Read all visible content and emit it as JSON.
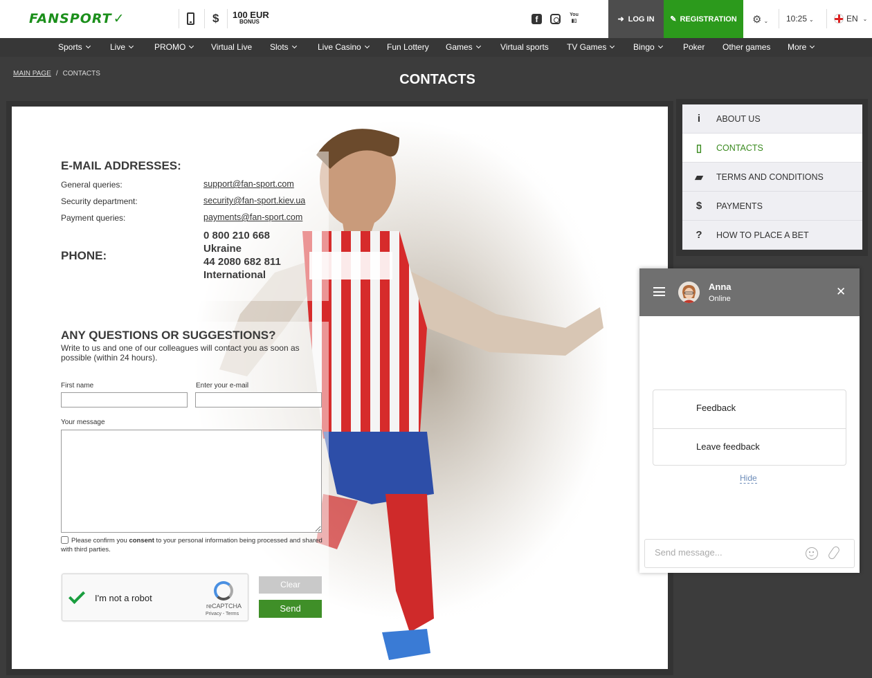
{
  "header": {
    "logo": "FANSPORT",
    "bonus_amount": "100 EUR",
    "bonus_label": "BONUS",
    "login": "LOG IN",
    "registration": "REGISTRATION",
    "time": "10:25",
    "language": "EN",
    "icons": [
      "mobile-phone-icon",
      "dollar-icon",
      "facebook-icon",
      "instagram-icon",
      "youtube-icon",
      "settings-icon",
      "uk-flag-icon"
    ]
  },
  "nav": [
    {
      "label": "Sports",
      "dropdown": true
    },
    {
      "label": "Live",
      "dropdown": true
    },
    {
      "label": "PROMO",
      "dropdown": true
    },
    {
      "label": "Virtual Live",
      "dropdown": false
    },
    {
      "label": "Slots",
      "dropdown": true
    },
    {
      "label": "Live Casino",
      "dropdown": true
    },
    {
      "label": "Fun Lottery",
      "dropdown": false
    },
    {
      "label": "Games",
      "dropdown": true
    },
    {
      "label": "Virtual sports",
      "dropdown": false
    },
    {
      "label": "TV Games",
      "dropdown": true
    },
    {
      "label": "Bingo",
      "dropdown": true
    },
    {
      "label": "Poker",
      "dropdown": false
    },
    {
      "label": "Other games",
      "dropdown": false
    },
    {
      "label": "More",
      "dropdown": true
    }
  ],
  "breadcrumb": {
    "home": "MAIN PAGE",
    "separator": "/",
    "current": "CONTACTS"
  },
  "page_title": "CONTACTS",
  "contacts": {
    "email_heading": "E-MAIL ADDRESSES:",
    "emails": [
      {
        "label": "General queries:",
        "address": "support@fan-sport.com"
      },
      {
        "label": "Security department:",
        "address": "security@fan-sport.kiev.ua"
      },
      {
        "label": "Payment queries:",
        "address": "payments@fan-sport.com"
      }
    ],
    "phone_heading": "PHONE:",
    "phones": [
      "0 800 210 668",
      "Ukraine",
      "44 2080 682 811",
      "International"
    ]
  },
  "form": {
    "heading": "ANY QUESTIONS OR SUGGESTIONS?",
    "description": "Write to us and one of our colleagues will contact you as soon as possible (within 24 hours).",
    "first_name_label": "First name",
    "email_label": "Enter your e-mail",
    "message_label": "Your message",
    "first_name_value": "",
    "email_value": "",
    "message_value": "",
    "consent_pre": "Please confirm you ",
    "consent_bold": "consent",
    "consent_post": " to your personal information being processed and shared with third parties.",
    "captcha_text": "I'm not a robot",
    "captcha_brand": "reCAPTCHA",
    "captcha_terms": "Privacy - Terms",
    "clear_button": "Clear",
    "send_button": "Send"
  },
  "sidebar": {
    "items": [
      {
        "label": "ABOUT US",
        "icon": "info-icon",
        "active": false
      },
      {
        "label": "CONTACTS",
        "icon": "mobile-phone-icon",
        "active": true
      },
      {
        "label": "TERMS AND CONDITIONS",
        "icon": "book-icon",
        "active": false
      },
      {
        "label": "PAYMENTS",
        "icon": "dollar-icon",
        "active": false
      },
      {
        "label": "HOW TO PLACE A BET",
        "icon": "question-icon",
        "active": false
      }
    ]
  },
  "chat": {
    "agent_name": "Anna",
    "agent_status": "Online",
    "options": [
      "Feedback",
      "Leave feedback"
    ],
    "hide": "Hide",
    "input_placeholder": "Send message..."
  },
  "colors": {
    "brand_green": "#2c9a1c",
    "active_green": "#3a8a1f",
    "dark_bg": "#3c3c3c",
    "nav_bg": "#373737",
    "chat_header": "#707070"
  }
}
